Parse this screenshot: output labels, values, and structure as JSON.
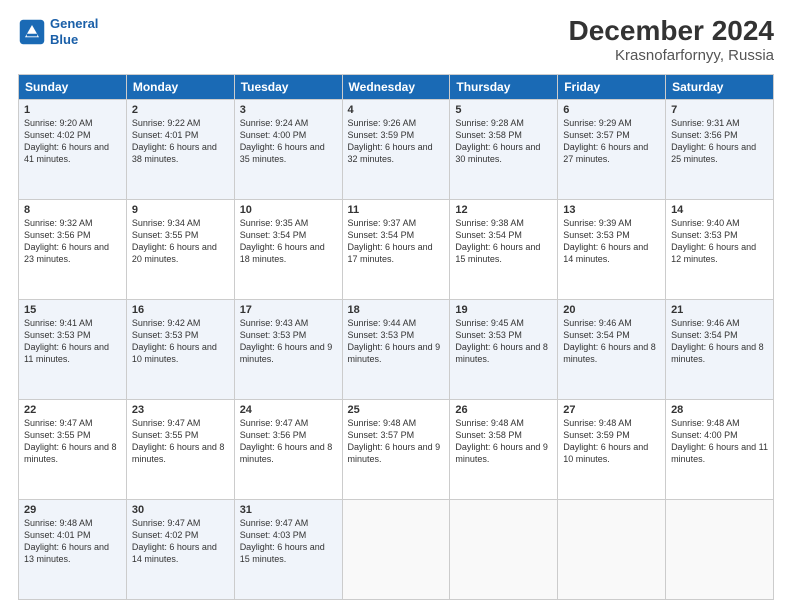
{
  "logo": {
    "line1": "General",
    "line2": "Blue"
  },
  "title": "December 2024",
  "location": "Krasnofarfornyy, Russia",
  "days_of_week": [
    "Sunday",
    "Monday",
    "Tuesday",
    "Wednesday",
    "Thursday",
    "Friday",
    "Saturday"
  ],
  "weeks": [
    [
      {
        "day": "1",
        "sunrise": "Sunrise: 9:20 AM",
        "sunset": "Sunset: 4:02 PM",
        "daylight": "Daylight: 6 hours and 41 minutes."
      },
      {
        "day": "2",
        "sunrise": "Sunrise: 9:22 AM",
        "sunset": "Sunset: 4:01 PM",
        "daylight": "Daylight: 6 hours and 38 minutes."
      },
      {
        "day": "3",
        "sunrise": "Sunrise: 9:24 AM",
        "sunset": "Sunset: 4:00 PM",
        "daylight": "Daylight: 6 hours and 35 minutes."
      },
      {
        "day": "4",
        "sunrise": "Sunrise: 9:26 AM",
        "sunset": "Sunset: 3:59 PM",
        "daylight": "Daylight: 6 hours and 32 minutes."
      },
      {
        "day": "5",
        "sunrise": "Sunrise: 9:28 AM",
        "sunset": "Sunset: 3:58 PM",
        "daylight": "Daylight: 6 hours and 30 minutes."
      },
      {
        "day": "6",
        "sunrise": "Sunrise: 9:29 AM",
        "sunset": "Sunset: 3:57 PM",
        "daylight": "Daylight: 6 hours and 27 minutes."
      },
      {
        "day": "7",
        "sunrise": "Sunrise: 9:31 AM",
        "sunset": "Sunset: 3:56 PM",
        "daylight": "Daylight: 6 hours and 25 minutes."
      }
    ],
    [
      {
        "day": "8",
        "sunrise": "Sunrise: 9:32 AM",
        "sunset": "Sunset: 3:56 PM",
        "daylight": "Daylight: 6 hours and 23 minutes."
      },
      {
        "day": "9",
        "sunrise": "Sunrise: 9:34 AM",
        "sunset": "Sunset: 3:55 PM",
        "daylight": "Daylight: 6 hours and 20 minutes."
      },
      {
        "day": "10",
        "sunrise": "Sunrise: 9:35 AM",
        "sunset": "Sunset: 3:54 PM",
        "daylight": "Daylight: 6 hours and 18 minutes."
      },
      {
        "day": "11",
        "sunrise": "Sunrise: 9:37 AM",
        "sunset": "Sunset: 3:54 PM",
        "daylight": "Daylight: 6 hours and 17 minutes."
      },
      {
        "day": "12",
        "sunrise": "Sunrise: 9:38 AM",
        "sunset": "Sunset: 3:54 PM",
        "daylight": "Daylight: 6 hours and 15 minutes."
      },
      {
        "day": "13",
        "sunrise": "Sunrise: 9:39 AM",
        "sunset": "Sunset: 3:53 PM",
        "daylight": "Daylight: 6 hours and 14 minutes."
      },
      {
        "day": "14",
        "sunrise": "Sunrise: 9:40 AM",
        "sunset": "Sunset: 3:53 PM",
        "daylight": "Daylight: 6 hours and 12 minutes."
      }
    ],
    [
      {
        "day": "15",
        "sunrise": "Sunrise: 9:41 AM",
        "sunset": "Sunset: 3:53 PM",
        "daylight": "Daylight: 6 hours and 11 minutes."
      },
      {
        "day": "16",
        "sunrise": "Sunrise: 9:42 AM",
        "sunset": "Sunset: 3:53 PM",
        "daylight": "Daylight: 6 hours and 10 minutes."
      },
      {
        "day": "17",
        "sunrise": "Sunrise: 9:43 AM",
        "sunset": "Sunset: 3:53 PM",
        "daylight": "Daylight: 6 hours and 9 minutes."
      },
      {
        "day": "18",
        "sunrise": "Sunrise: 9:44 AM",
        "sunset": "Sunset: 3:53 PM",
        "daylight": "Daylight: 6 hours and 9 minutes."
      },
      {
        "day": "19",
        "sunrise": "Sunrise: 9:45 AM",
        "sunset": "Sunset: 3:53 PM",
        "daylight": "Daylight: 6 hours and 8 minutes."
      },
      {
        "day": "20",
        "sunrise": "Sunrise: 9:46 AM",
        "sunset": "Sunset: 3:54 PM",
        "daylight": "Daylight: 6 hours and 8 minutes."
      },
      {
        "day": "21",
        "sunrise": "Sunrise: 9:46 AM",
        "sunset": "Sunset: 3:54 PM",
        "daylight": "Daylight: 6 hours and 8 minutes."
      }
    ],
    [
      {
        "day": "22",
        "sunrise": "Sunrise: 9:47 AM",
        "sunset": "Sunset: 3:55 PM",
        "daylight": "Daylight: 6 hours and 8 minutes."
      },
      {
        "day": "23",
        "sunrise": "Sunrise: 9:47 AM",
        "sunset": "Sunset: 3:55 PM",
        "daylight": "Daylight: 6 hours and 8 minutes."
      },
      {
        "day": "24",
        "sunrise": "Sunrise: 9:47 AM",
        "sunset": "Sunset: 3:56 PM",
        "daylight": "Daylight: 6 hours and 8 minutes."
      },
      {
        "day": "25",
        "sunrise": "Sunrise: 9:48 AM",
        "sunset": "Sunset: 3:57 PM",
        "daylight": "Daylight: 6 hours and 9 minutes."
      },
      {
        "day": "26",
        "sunrise": "Sunrise: 9:48 AM",
        "sunset": "Sunset: 3:58 PM",
        "daylight": "Daylight: 6 hours and 9 minutes."
      },
      {
        "day": "27",
        "sunrise": "Sunrise: 9:48 AM",
        "sunset": "Sunset: 3:59 PM",
        "daylight": "Daylight: 6 hours and 10 minutes."
      },
      {
        "day": "28",
        "sunrise": "Sunrise: 9:48 AM",
        "sunset": "Sunset: 4:00 PM",
        "daylight": "Daylight: 6 hours and 11 minutes."
      }
    ],
    [
      {
        "day": "29",
        "sunrise": "Sunrise: 9:48 AM",
        "sunset": "Sunset: 4:01 PM",
        "daylight": "Daylight: 6 hours and 13 minutes."
      },
      {
        "day": "30",
        "sunrise": "Sunrise: 9:47 AM",
        "sunset": "Sunset: 4:02 PM",
        "daylight": "Daylight: 6 hours and 14 minutes."
      },
      {
        "day": "31",
        "sunrise": "Sunrise: 9:47 AM",
        "sunset": "Sunset: 4:03 PM",
        "daylight": "Daylight: 6 hours and 15 minutes."
      },
      null,
      null,
      null,
      null
    ]
  ]
}
